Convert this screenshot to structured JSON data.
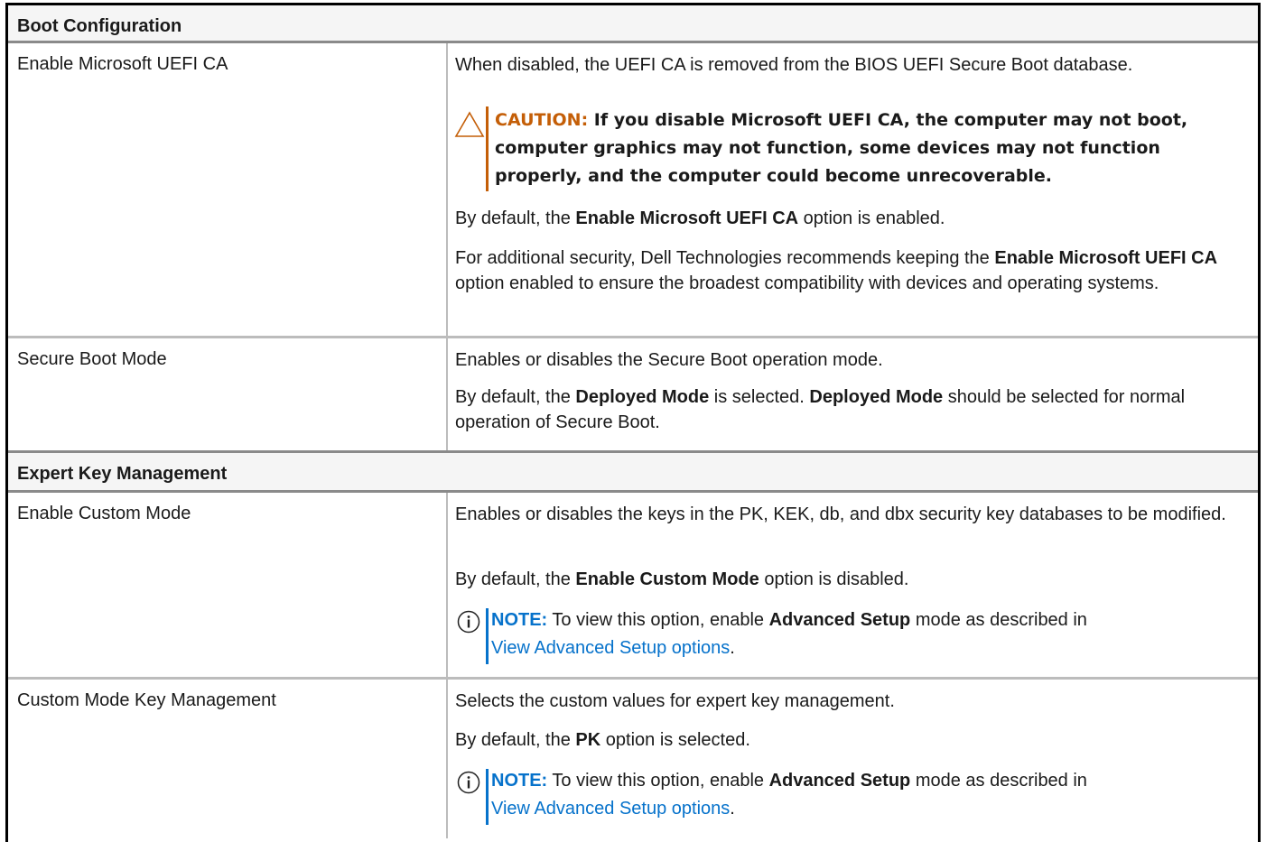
{
  "sections": [
    {
      "title": "Boot Configuration"
    },
    {
      "title": "Expert Key Management"
    }
  ],
  "rows": [
    {
      "label": "Enable Microsoft UEFI CA",
      "desc1": "When disabled, the UEFI CA is removed from the BIOS UEFI Secure Boot database.",
      "caution_word": "CAUTION:",
      "caution_text": " If you disable Microsoft UEFI CA, the computer may not boot, computer graphics may not function, some devices may not function properly, and the computer could become unrecoverable.",
      "d2_a": "By default, the ",
      "d2_b": "Enable Microsoft UEFI CA",
      "d2_c": " option is enabled.",
      "d3_a": "For additional security, Dell Technologies recommends keeping the ",
      "d3_b": "Enable Microsoft UEFI CA",
      "d3_c": " option enabled to ensure the broadest compatibility with devices and operating systems."
    },
    {
      "label": "Secure Boot Mode",
      "desc1": "Enables or disables the Secure Boot operation mode.",
      "d2_a": "By default, the ",
      "d2_b": "Deployed Mode",
      "d2_c": " is selected. ",
      "d2_d": "Deployed Mode",
      "d2_e": " should be selected for normal operation of Secure Boot."
    },
    {
      "label": "Enable Custom Mode",
      "desc1": "Enables or disables the keys in the PK, KEK, db, and dbx security key databases to be modified.",
      "d2_a": "By default, the ",
      "d2_b": "Enable Custom Mode",
      "d2_c": " option is disabled.",
      "note_word": "NOTE:",
      "note_a": " To view this option, enable ",
      "note_b": "Advanced Setup",
      "note_c": " mode as described in ",
      "note_link": "View Advanced Setup options",
      "note_end": "."
    },
    {
      "label": "Custom Mode Key Management",
      "desc1": "Selects the custom values for expert key management.",
      "d2_a": "By default, the ",
      "d2_b": "PK",
      "d2_c": " option is selected.",
      "note_word": "NOTE:",
      "note_a": " To view this option, enable ",
      "note_b": "Advanced Setup",
      "note_c": " mode as described in ",
      "note_link": "View Advanced Setup options",
      "note_end": "."
    }
  ],
  "colors": {
    "caution": "#c45e07",
    "note": "#0672cb",
    "header_bg": "#f5f5f5"
  },
  "icons": [
    "caution-triangle-icon",
    "info-circle-icon"
  ]
}
